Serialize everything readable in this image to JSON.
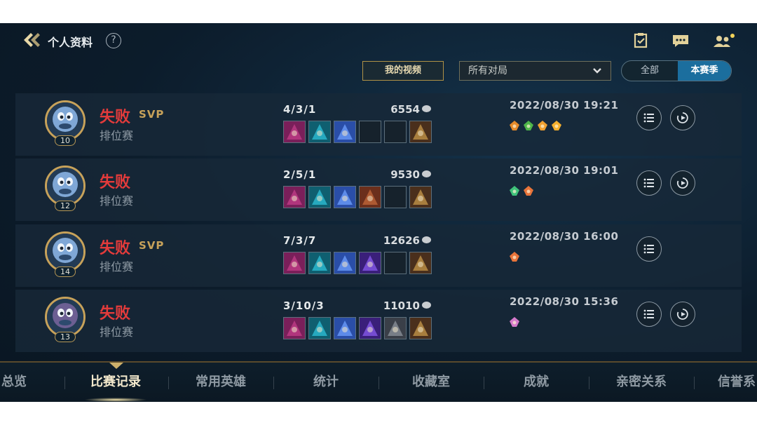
{
  "header": {
    "title": "个人资料",
    "help_glyph": "?",
    "right_icons": [
      "clipboard-check-icon",
      "chat-icon",
      "friends-icon"
    ]
  },
  "filters": {
    "video_button": "我的视频",
    "match_filter": "所有对局",
    "toggle_all": "全部",
    "toggle_season": "本赛季",
    "selected": "本赛季"
  },
  "matches": [
    {
      "level": "10",
      "result": "失败",
      "svp": "SVP",
      "mode": "排位赛",
      "kda": "4/3/1",
      "gold": "6554",
      "datetime": "2022/08/30 19:21",
      "items": [
        "item-1",
        "item-2",
        "item-3",
        "empty",
        "empty",
        "item-boots"
      ],
      "badges": [
        "badge-orange-1",
        "badge-green-flag",
        "badge-fire",
        "badge-flame"
      ],
      "has_replay": true
    },
    {
      "level": "12",
      "result": "失败",
      "svp": "",
      "mode": "排位赛",
      "kda": "2/5/1",
      "gold": "9530",
      "datetime": "2022/08/30 19:01",
      "items": [
        "item-1",
        "item-2",
        "item-3",
        "item-book",
        "empty",
        "item-boots"
      ],
      "badges": [
        "badge-green-heart",
        "badge-orange-2"
      ],
      "has_replay": true
    },
    {
      "level": "14",
      "result": "失败",
      "svp": "SVP",
      "mode": "排位赛",
      "kda": "7/3/7",
      "gold": "12626",
      "datetime": "2022/08/30 16:00",
      "items": [
        "item-1",
        "item-2",
        "item-3",
        "item-4",
        "empty",
        "item-boots"
      ],
      "badges": [
        "badge-orange-2"
      ],
      "has_replay": false
    },
    {
      "level": "13",
      "result": "失败",
      "svp": "",
      "mode": "排位赛",
      "kda": "3/10/3",
      "gold": "11010",
      "datetime": "2022/08/30 15:36",
      "items": [
        "item-1",
        "item-2",
        "item-3",
        "item-4",
        "item-5",
        "item-boots"
      ],
      "badges": [
        "badge-pink"
      ],
      "has_replay": true
    }
  ],
  "nav": {
    "items": [
      "总览",
      "比赛记录",
      "常用英雄",
      "统计",
      "收藏室",
      "成就",
      "亲密关系",
      "信誉系"
    ],
    "active": "比赛记录"
  },
  "colors": {
    "loss": "#e23b3b",
    "gold_accent": "#c7a25a",
    "toggle_active": "#1b6e9e"
  }
}
